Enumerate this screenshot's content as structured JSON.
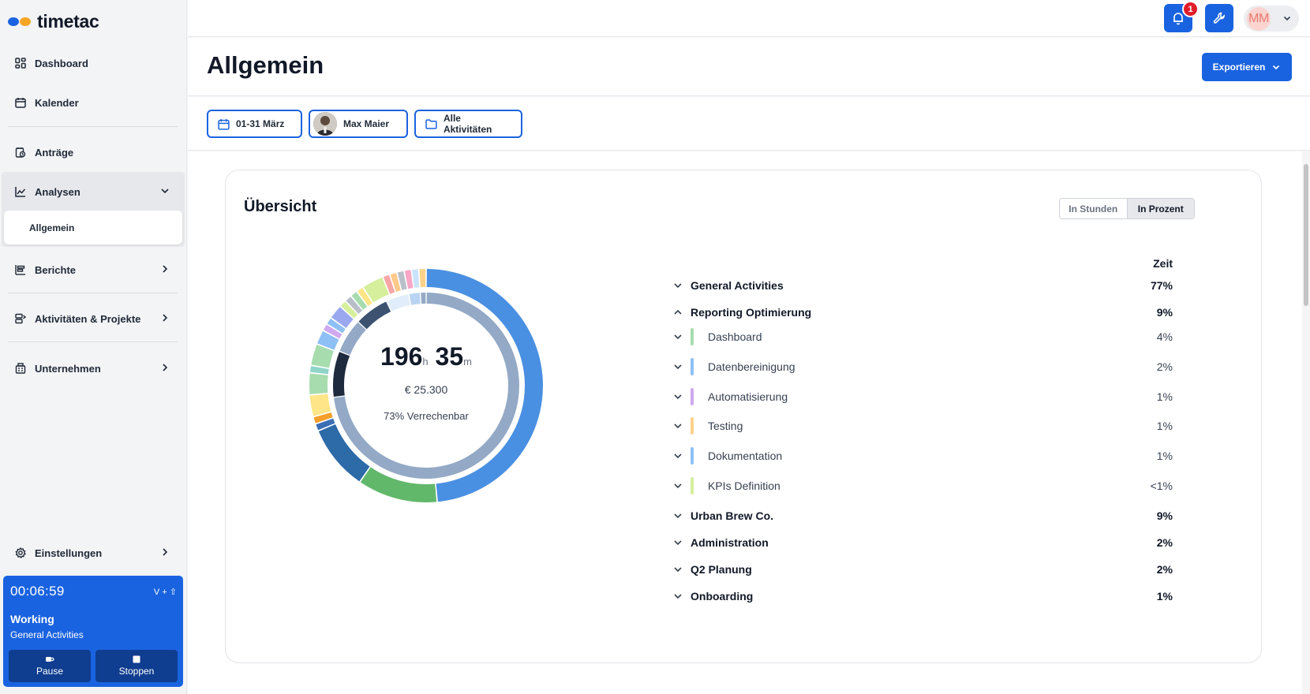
{
  "brand": {
    "name": "timetac",
    "dot_colors": [
      "#1a63e0",
      "#f5a524"
    ]
  },
  "nav": {
    "dashboard": "Dashboard",
    "kalender": "Kalender",
    "antraege": "Anträge",
    "analysen": "Analysen",
    "allgemein": "Allgemein",
    "berichte": "Berichte",
    "aktivitaeten": "Aktivitäten & Projekte",
    "unternehmen": "Unternehmen",
    "einstellungen": "Einstellungen"
  },
  "timer": {
    "time": "00:06:59",
    "shortcut": "V + ⇧",
    "state": "Working",
    "activity": "General Activities",
    "pause_label": "Pause",
    "stop_label": "Stoppen"
  },
  "topbar": {
    "notification_count": "1",
    "user_initials": "MM"
  },
  "page": {
    "title": "Allgemein",
    "export_label": "Exportieren"
  },
  "filters": {
    "date_range": "01-31 März",
    "person": "Max Maier",
    "activities": "Alle Aktivitäten"
  },
  "overview": {
    "title": "Übersicht",
    "toggle_hours": "In Stunden",
    "toggle_percent": "In Prozent",
    "toggle_active": "In Prozent",
    "total_hours": "196",
    "hours_unit": "h",
    "total_minutes": "35",
    "minutes_unit": "m",
    "total_amount": "€  25.300",
    "billable": "73%  Verrechenbar",
    "column_header": "Zeit",
    "rows": [
      {
        "label": "General Activities",
        "value": "77%",
        "expanded": false,
        "level": 0
      },
      {
        "label": "Reporting Optimierung",
        "value": "9%",
        "expanded": true,
        "level": 0
      },
      {
        "label": "Dashboard",
        "value": "4%",
        "level": 1,
        "color": "#a7dcae"
      },
      {
        "label": "Datenbereinigung",
        "value": "2%",
        "level": 1,
        "color": "#8ec0f5"
      },
      {
        "label": "Automatisierung",
        "value": "1%",
        "level": 1,
        "color": "#cfa9ef"
      },
      {
        "label": "Testing",
        "value": "1%",
        "level": 1,
        "color": "#ffd28a"
      },
      {
        "label": "Dokumentation",
        "value": "1%",
        "level": 1,
        "color": "#8ec0f5"
      },
      {
        "label": "KPIs Definition",
        "value": "<1%",
        "level": 1,
        "color": "#d6ef9c"
      },
      {
        "label": "Urban Brew Co.",
        "value": "9%",
        "level": 0
      },
      {
        "label": "Administration",
        "value": "2%",
        "level": 0
      },
      {
        "label": "Q2 Planung",
        "value": "2%",
        "level": 0
      },
      {
        "label": "Onboarding",
        "value": "1%",
        "level": 0
      }
    ]
  },
  "chart_data": {
    "type": "pie",
    "outer_ring_percent": [
      {
        "label": "General Activities",
        "value": 48,
        "color": "#4a90e2"
      },
      {
        "label": "",
        "value": 11,
        "color": "#62b86a"
      },
      {
        "label": "",
        "value": 9,
        "color": "#2d6aa8"
      },
      {
        "label": "",
        "value": 1,
        "color": "#3a6fb5"
      },
      {
        "label": "",
        "value": 1,
        "color": "#f59e2a"
      },
      {
        "label": "",
        "value": 3,
        "color": "#fde588"
      },
      {
        "label": "",
        "value": 3,
        "color": "#a7dcae"
      },
      {
        "label": "",
        "value": 1,
        "color": "#8fd4c9"
      },
      {
        "label": "",
        "value": 3,
        "color": "#a7dcae"
      },
      {
        "label": "",
        "value": 2,
        "color": "#8ec0f5"
      },
      {
        "label": "",
        "value": 1,
        "color": "#cfa9ef"
      },
      {
        "label": "",
        "value": 1,
        "color": "#8ec0f5"
      },
      {
        "label": "",
        "value": 2,
        "color": "#9aa8f0"
      },
      {
        "label": "",
        "value": 1,
        "color": "#d6ef9c"
      },
      {
        "label": "",
        "value": 1,
        "color": "#b8bfc9"
      },
      {
        "label": "",
        "value": 1,
        "color": "#a7dcae"
      },
      {
        "label": "",
        "value": 1,
        "color": "#fde588"
      },
      {
        "label": "",
        "value": 3,
        "color": "#d6ef9c"
      },
      {
        "label": "",
        "value": 1,
        "color": "#f7a6a6"
      },
      {
        "label": "",
        "value": 1,
        "color": "#ffc98a"
      },
      {
        "label": "",
        "value": 1,
        "color": "#b8bfc9"
      },
      {
        "label": "",
        "value": 1,
        "color": "#f7a6c5"
      },
      {
        "label": "",
        "value": 1,
        "color": "#c9e3fa"
      },
      {
        "label": "",
        "value": 1,
        "color": "#ffd28a"
      }
    ],
    "inner_ring_percent": [
      {
        "label": "",
        "value": 73,
        "color": "#93a9c6"
      },
      {
        "label": "",
        "value": 8,
        "color": "#1e2a3d"
      },
      {
        "label": "",
        "value": 6,
        "color": "#93a9c6"
      },
      {
        "label": "",
        "value": 6,
        "color": "#3c5270"
      },
      {
        "label": "",
        "value": 4,
        "color": "#e2edfb"
      },
      {
        "label": "",
        "value": 2,
        "color": "#b9d4f2"
      },
      {
        "label": "",
        "value": 1,
        "color": "#93a9c6"
      }
    ]
  }
}
